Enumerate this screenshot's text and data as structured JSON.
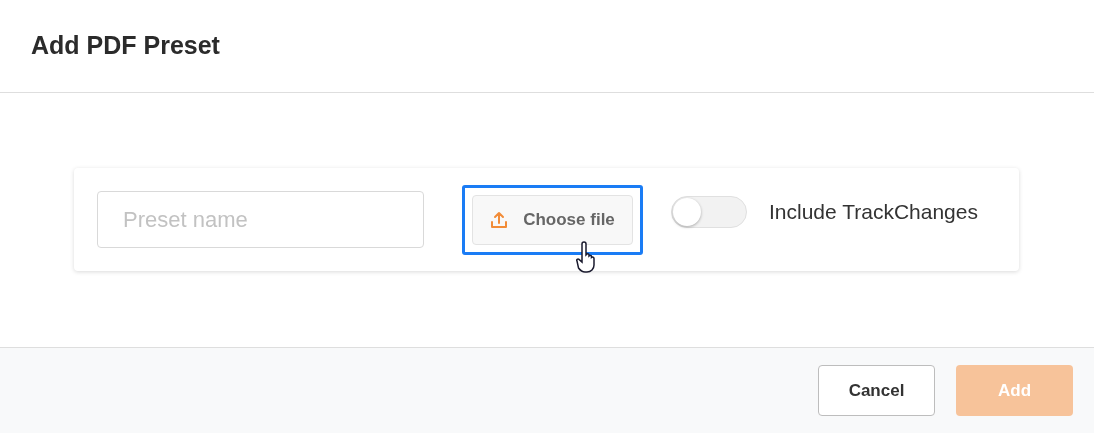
{
  "dialog": {
    "title": "Add PDF Preset"
  },
  "form": {
    "preset_name": {
      "placeholder": "Preset name"
    },
    "choose_file": {
      "label": "Choose file",
      "focused": true
    },
    "track_changes": {
      "label": "Include TrackChanges",
      "on": false
    }
  },
  "buttons": [
    {
      "label": "Cancel",
      "kind": "secondary",
      "disabled": false
    },
    {
      "label": "Add",
      "kind": "primary",
      "disabled": true
    }
  ]
}
